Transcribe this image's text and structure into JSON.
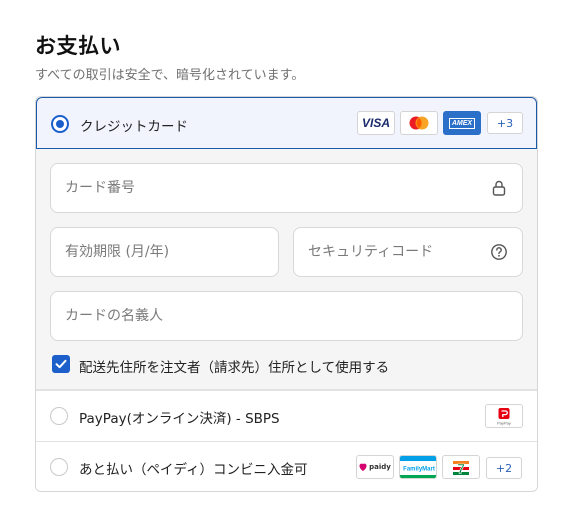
{
  "header": {
    "title": "お支払い",
    "subtitle": "すべての取引は安全で、暗号化されています。"
  },
  "methods": {
    "credit_card": {
      "label": "クレジットカード",
      "selected": true,
      "logos": [
        "VISA",
        "Mastercard",
        "AMEX"
      ],
      "visa_text": "VISA",
      "amex_text": "AMEX",
      "more_count": "+3"
    },
    "paypay": {
      "label": "PayPay(オンライン決済) - SBPS",
      "selected": false,
      "logo_text": "PayPay"
    },
    "paidy": {
      "label": "あと払い（ペイディ）コンビニ入金可",
      "selected": false,
      "paidy_text": "paidy",
      "familymart_text": "FamilyMart",
      "seven_text": "7",
      "more_count": "+2"
    }
  },
  "card_form": {
    "card_number": {
      "value": "",
      "placeholder": "カード番号"
    },
    "expiry": {
      "value": "",
      "placeholder": "有効期限 (月/年)"
    },
    "security_code": {
      "value": "",
      "placeholder": "セキュリティコード"
    },
    "card_holder": {
      "value": "",
      "placeholder": "カードの名義人"
    },
    "billing_checkbox": {
      "label": "配送先住所を注文者（請求先）住所として使用する",
      "checked": true
    }
  },
  "colors": {
    "accent": "#1c5fcb",
    "selected_bg": "#f1f3fd",
    "panel_bg": "#f5f5f5"
  },
  "icons": [
    "lock-icon",
    "help-circle-icon",
    "checkmark-icon"
  ]
}
